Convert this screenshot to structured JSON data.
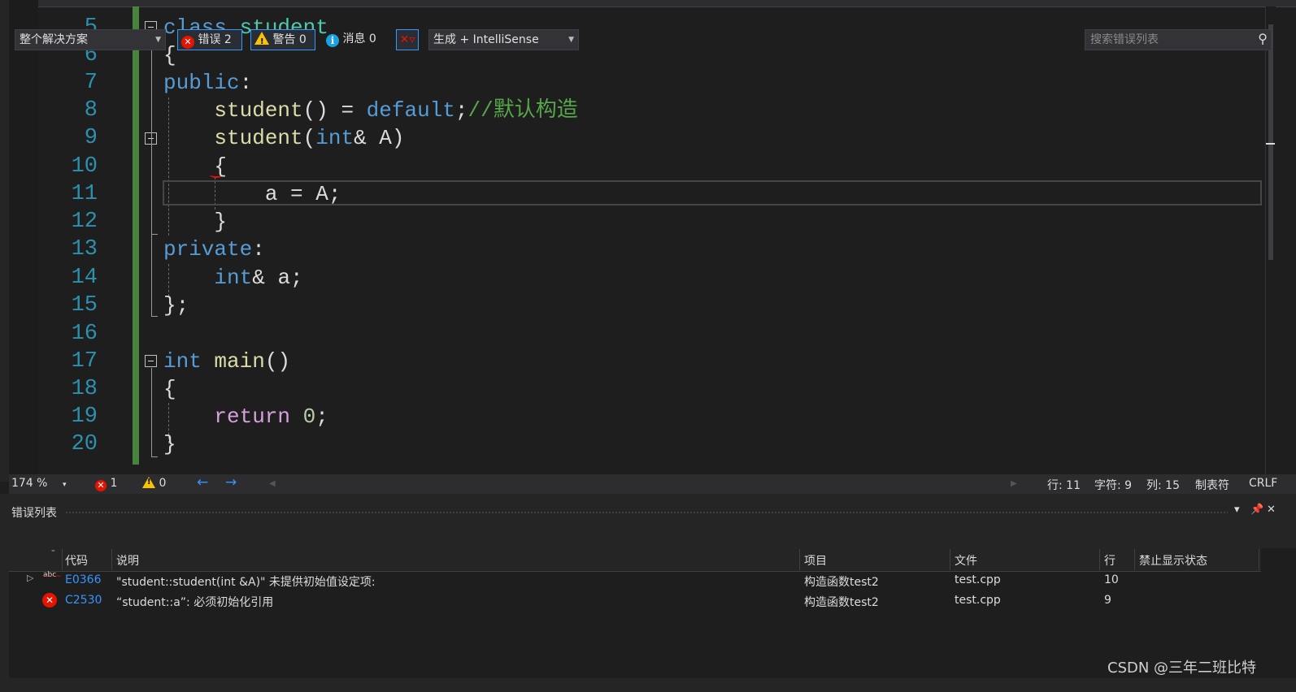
{
  "editor": {
    "lines": [
      {
        "n": "5"
      },
      {
        "n": "6"
      },
      {
        "n": "7"
      },
      {
        "n": "8"
      },
      {
        "n": "9"
      },
      {
        "n": "10"
      },
      {
        "n": "11"
      },
      {
        "n": "12"
      },
      {
        "n": "13"
      },
      {
        "n": "14"
      },
      {
        "n": "15"
      },
      {
        "n": "16"
      },
      {
        "n": "17"
      },
      {
        "n": "18"
      },
      {
        "n": "19"
      },
      {
        "n": "20"
      }
    ],
    "code": {
      "l5_kw": "class",
      "l5_name": "student",
      "l6": "{",
      "l7_kw": "public",
      "l7_colon": ":",
      "l8_fn": "student",
      "l8_mid": "() = ",
      "l8_kw": "default",
      "l8_semi": ";",
      "l8_comment": "//默认构造",
      "l9_fn": "student",
      "l9_open": "(",
      "l9_kw": "int",
      "l9_rest": "& A)",
      "l10": "{",
      "l11": "a = A;",
      "l12": "}",
      "l13_kw": "private",
      "l13_colon": ":",
      "l14_kw": "int",
      "l14_rest": "& a;",
      "l15": "};",
      "l17_kw": "int",
      "l17_fn": "main",
      "l17_rest": "()",
      "l18": "{",
      "l19_kw": "return",
      "l19_num": "0",
      "l19_semi": ";",
      "l20": "}"
    }
  },
  "status": {
    "zoom": "174 %",
    "errors": "1",
    "warnings": "0",
    "line": "行: 11",
    "char": "字符: 9",
    "col": "列: 15",
    "tabs": "制表符",
    "eol": "CRLF"
  },
  "error_list": {
    "title": "错误列表",
    "scope": "整个解决方案",
    "errors_btn": "错误 2",
    "warnings_btn": "警告 0",
    "messages_btn": "消息 0",
    "build_filter": "生成 + IntelliSense",
    "search_placeholder": "搜索错误列表",
    "columns": {
      "code": "代码",
      "desc": "说明",
      "project": "项目",
      "file": "文件",
      "line": "行",
      "suppress": "禁止显示状态"
    },
    "rows": [
      {
        "code": "E0366",
        "desc": "\"student::student(int &A)\" 未提供初始值设定项:",
        "project": "构造函数test2",
        "file": "test.cpp",
        "line": "10",
        "kind_icon": "abc-squiggle-icon"
      },
      {
        "code": "C2530",
        "desc": "“student::a”: 必须初始化引用",
        "project": "构造函数test2",
        "file": "test.cpp",
        "line": "9",
        "kind_icon": "error-icon"
      }
    ]
  },
  "watermark": "CSDN @三年二班比特",
  "colors": {
    "keyword": "#569cd6",
    "type": "#4ec9b0",
    "function": "#dcdcaa",
    "comment": "#57a64a",
    "control": "#d8a0df",
    "line_number": "#2b91af",
    "error": "#e51400",
    "link": "#3794ff"
  }
}
